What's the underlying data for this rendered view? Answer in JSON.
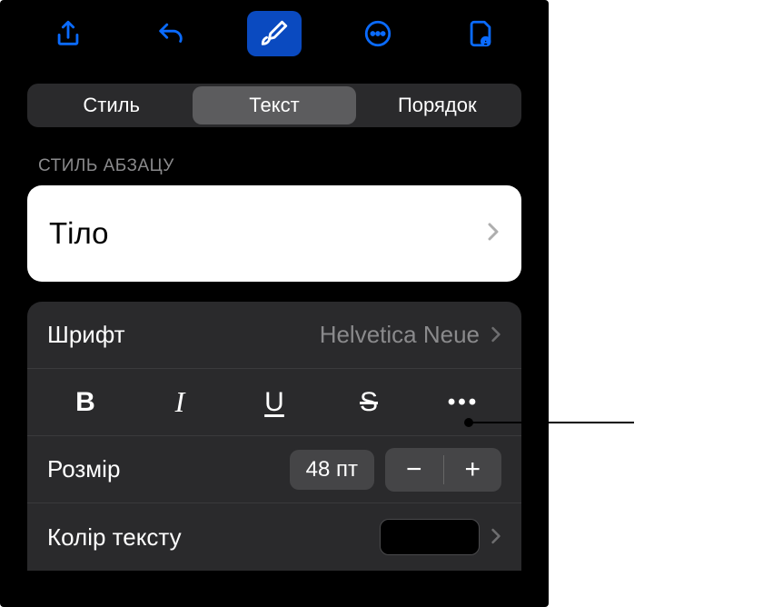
{
  "toolbar": {
    "share": "share-icon",
    "undo": "undo-icon",
    "format": "format-icon",
    "more": "more-icon",
    "document": "document-icon"
  },
  "segmented": {
    "style": "Стиль",
    "text": "Текст",
    "arrange": "Порядок"
  },
  "paragraph_style": {
    "label": "СТИЛЬ АБЗАЦУ",
    "value": "Тіло"
  },
  "font": {
    "label": "Шрифт",
    "name": "Helvetica Neue",
    "bold": "B",
    "italic": "I",
    "underline": "U",
    "strike": "S",
    "more": "•••"
  },
  "size": {
    "label": "Розмір",
    "value": "48 пт",
    "minus": "−",
    "plus": "+"
  },
  "text_color": {
    "label": "Колір тексту",
    "value": "#000000"
  }
}
